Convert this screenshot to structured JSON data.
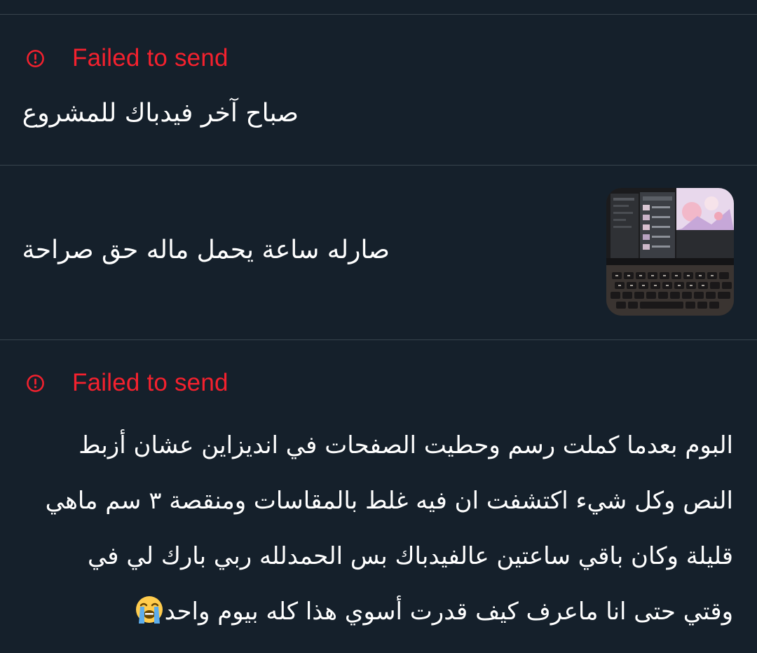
{
  "messages": [
    {
      "status": "Failed to send",
      "text": "صباح آخر فيدباك للمشروع"
    },
    {
      "text": "صارله ساعة يحمل ماله حق صراحة",
      "attachment_icon": "laptop-photo-thumbnail"
    },
    {
      "status": "Failed to send",
      "lines": [
        "البوم بعدما كملت رسم وحطيت الصفحات في انديزاين عشان أزبط",
        "النص وكل شيء اكتشفت ان فيه غلط بالمقاسات ومنقصة ٣ سم ماهي",
        "قليلة  وكان باقي ساعتين عالفيدباك بس الحمدلله ربي بارك لي في",
        "وقتي حتى انا ماعرف كيف قدرت أسوي هذا كله بيوم واحد"
      ],
      "trailing_emoji": "loudly-crying-face-emoji"
    }
  ],
  "colors": {
    "background": "#15202b",
    "divider": "#38444d",
    "error": "#f4212e",
    "text": "#ffffff"
  }
}
